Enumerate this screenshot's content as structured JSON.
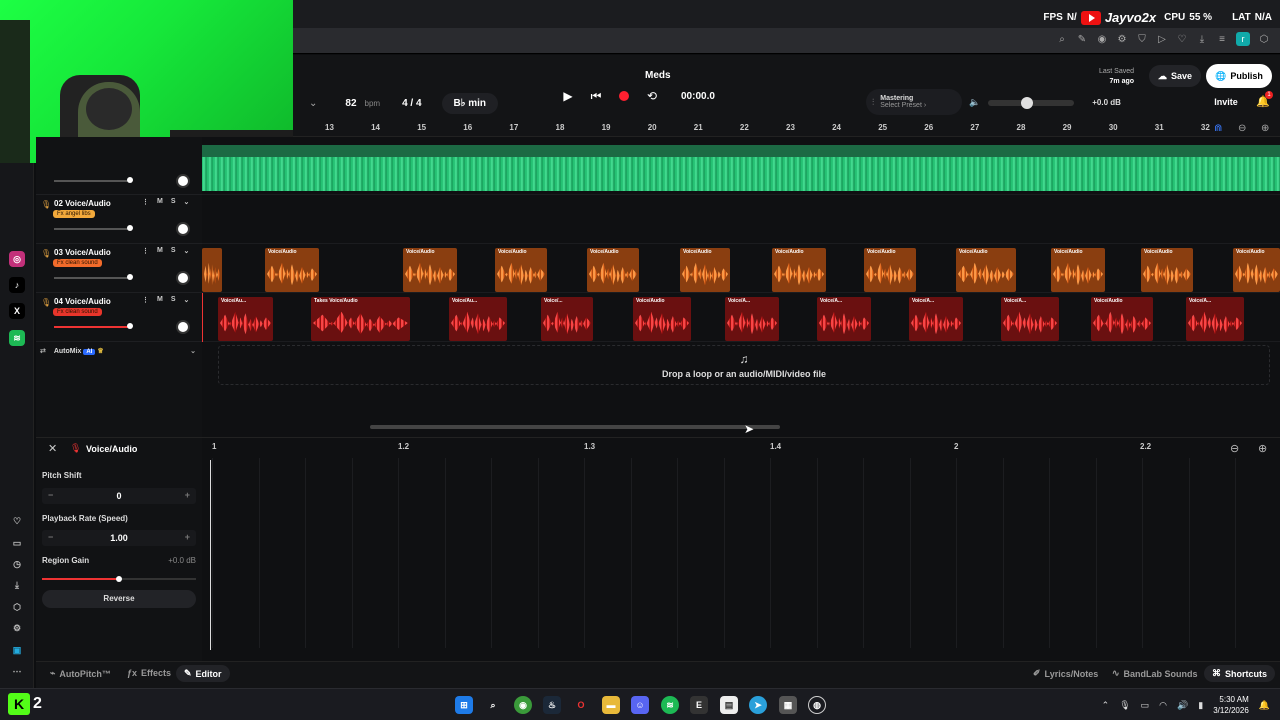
{
  "overlay": {
    "fps_label": "FPS",
    "fps_value": "N/",
    "channel_name": "Jayvo2x",
    "cpu_label": "CPU",
    "cpu_value": "55 %",
    "lat_label": "LAT",
    "lat_value": "N/A"
  },
  "project": {
    "title": "Meds",
    "bpm": "82",
    "bpm_unit": "bpm",
    "time_signature": "4 / 4",
    "key": "B♭ min",
    "time": "00:00.0",
    "mastering_label": "Mastering",
    "mastering_preset": "Select Preset ›",
    "volume_db": "+0.0 dB",
    "volume_level": 0.45,
    "last_saved_label": "Last Saved",
    "last_saved_value": "7m ago",
    "save_label": "Save",
    "publish_label": "Publish",
    "invite_label": "Invite",
    "notification_count": "1"
  },
  "ruler": [
    "13",
    "14",
    "15",
    "16",
    "17",
    "18",
    "19",
    "20",
    "21",
    "22",
    "23",
    "24",
    "25",
    "26",
    "27",
    "28",
    "29",
    "30",
    "31",
    "32"
  ],
  "tracks": [
    {
      "name": "02 Voice/Audio",
      "fx": "Fx angel libs",
      "fx_color": "#f2a93b"
    },
    {
      "name": "03 Voice/Audio",
      "fx": "Fx clean sound",
      "fx_color": "#f26b2b"
    },
    {
      "name": "04 Voice/Audio",
      "fx": "Fx clean sound",
      "fx_color": "#e8352b"
    }
  ],
  "track_buttons": {
    "mute": "M",
    "solo": "S"
  },
  "automix": {
    "label": "AutoMix",
    "badge": "AI"
  },
  "clips": {
    "track3_label": "Voice/Audio",
    "track4_labels": [
      "Voice/Au...",
      "Takes  Voice/Audio",
      "Voice/Au...",
      "Voice/...",
      "Voice/Audio",
      "Voice/A...",
      "Voice/A...",
      "Voice/A...",
      "Voice/A...",
      "Voice/Audio",
      "Voice/A..."
    ]
  },
  "dropzone": {
    "text": "Drop a loop or an audio/MIDI/video file"
  },
  "editor": {
    "title": "Voice/Audio",
    "pitch_label": "Pitch Shift",
    "pitch_value": "0",
    "rate_label": "Playback Rate (Speed)",
    "rate_value": "1.00",
    "gain_label": "Region Gain",
    "gain_value": "+0.0 dB",
    "reverse_label": "Reverse",
    "ruler": [
      "1",
      "1.2",
      "1.3",
      "1.4",
      "2",
      "2.2"
    ]
  },
  "bottombar": {
    "autopitch": "AutoPitch™",
    "effects": "Effects",
    "editor": "Editor",
    "lyrics": "Lyrics/Notes",
    "sounds": "BandLab Sounds",
    "shortcuts": "Shortcuts"
  },
  "taskbar": {
    "stream_number": "2",
    "time": "5:30 AM",
    "date": "3/12/2026"
  },
  "colors": {
    "accent_green": "#53fc18",
    "track3_clip": "#f26b2b",
    "track4_clip": "#e8352b",
    "record": "#ff2030"
  }
}
